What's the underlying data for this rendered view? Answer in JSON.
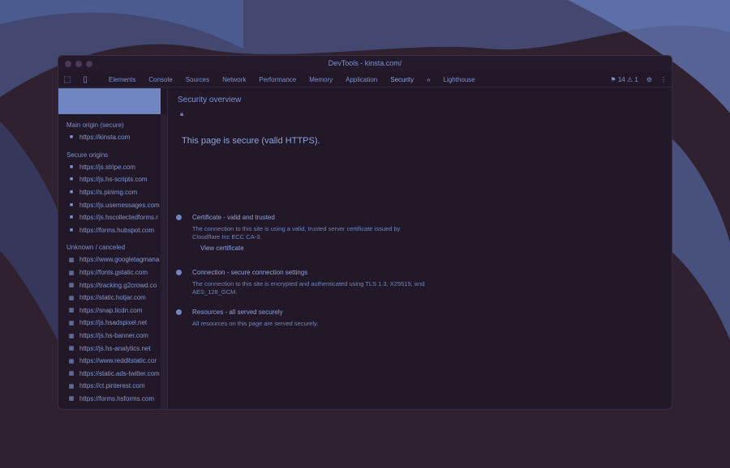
{
  "window": {
    "title": "DevTools - kinsta.com/"
  },
  "toolbar": {
    "inspect_icon": "cursor-inspect-icon",
    "device_icon": "device-toolbar-icon",
    "tabs": [
      {
        "label": "Elements"
      },
      {
        "label": "Console"
      },
      {
        "label": "Sources"
      },
      {
        "label": "Network"
      },
      {
        "label": "Performance"
      },
      {
        "label": "Memory"
      },
      {
        "label": "Application"
      },
      {
        "label": "Security"
      },
      {
        "label": "Lighthouse"
      }
    ],
    "active_tab": "Security",
    "more_tabs_glyph": "»",
    "warning_count": "14",
    "error_count": "1",
    "settings_icon": "gear-icon",
    "menu_icon": "kebab-menu-icon"
  },
  "sidebar": {
    "groups": [
      {
        "label": "Main origin (secure)",
        "items": [
          {
            "label": "https://kinsta.com",
            "icon": "lock-icon"
          }
        ]
      },
      {
        "label": "Secure origins",
        "items": [
          {
            "label": "https://js.stripe.com",
            "icon": "lock-icon"
          },
          {
            "label": "https://js.hs-scripts.com",
            "icon": "lock-icon"
          },
          {
            "label": "https://s.pinimg.com",
            "icon": "lock-icon"
          },
          {
            "label": "https://js.usemessages.com",
            "icon": "lock-icon"
          },
          {
            "label": "https://js.hscollectedforms.r",
            "icon": "lock-icon"
          },
          {
            "label": "https://forms.hubspot.com",
            "icon": "lock-icon"
          }
        ]
      },
      {
        "label": "Unknown / canceled",
        "items": [
          {
            "label": "https://www.googletagmana",
            "icon": "unknown-icon"
          },
          {
            "label": "https://fonts.gstatic.com",
            "icon": "unknown-icon"
          },
          {
            "label": "https://tracking.g2crowd.co",
            "icon": "unknown-icon"
          },
          {
            "label": "https://static.hotjar.com",
            "icon": "unknown-icon"
          },
          {
            "label": "https://snap.licdn.com",
            "icon": "unknown-icon"
          },
          {
            "label": "https://js.hsadspixel.net",
            "icon": "unknown-icon"
          },
          {
            "label": "https://js.hs-banner.com",
            "icon": "unknown-icon"
          },
          {
            "label": "https://js.hs-analytics.net",
            "icon": "unknown-icon"
          },
          {
            "label": "https://www.redditstatic.cor",
            "icon": "unknown-icon"
          },
          {
            "label": "https://static.ads-twitter.com",
            "icon": "unknown-icon"
          },
          {
            "label": "https://ct.pinterest.com",
            "icon": "unknown-icon"
          },
          {
            "label": "https://forms.hsforms.com",
            "icon": "unknown-icon"
          }
        ]
      }
    ]
  },
  "main": {
    "title": "Security overview",
    "headline": "This page is secure (valid HTTPS).",
    "sections": [
      {
        "heading": "Certificate - valid and trusted",
        "body": "The connection to this site is using a valid, trusted server certificate issued by Cloudflare Inc ECC CA-3.",
        "link": "View certificate"
      },
      {
        "heading": "Connection - secure connection settings",
        "body": "The connection to this site is encrypted and authenticated using TLS 1.3, X25519, and AES_128_GCM."
      },
      {
        "heading": "Resources - all served securely",
        "body": "All resources on this page are served securely."
      }
    ]
  },
  "colors": {
    "background": "#2f2130",
    "window": "#221828",
    "accent": "#6f86c2",
    "text": "#8ea4e0"
  }
}
